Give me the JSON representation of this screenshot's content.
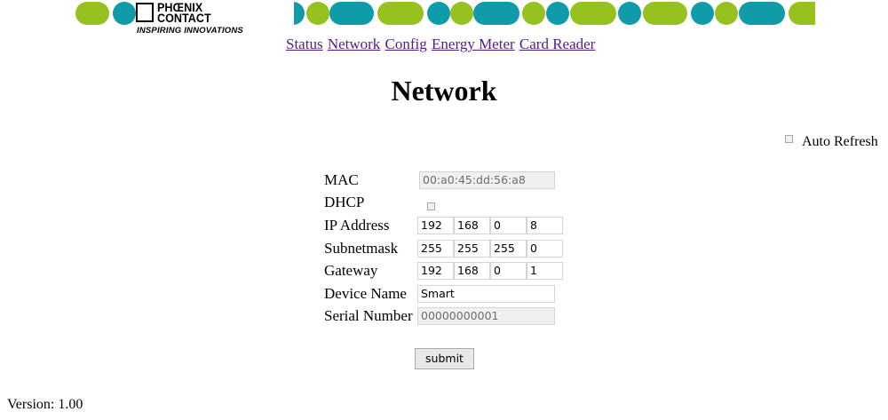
{
  "brand": {
    "logo_line1": "PHŒNIX",
    "logo_line2": "CONTACT",
    "tagline": "INSPIRING INNOVATIONS",
    "colors": {
      "green": "#96c11f",
      "teal": "#0f9ba7"
    }
  },
  "nav": {
    "items": [
      "Status",
      "Network",
      "Config",
      "Energy Meter",
      "Card Reader"
    ]
  },
  "page_title": "Network",
  "auto_refresh": {
    "label": "Auto Refresh",
    "checked": false
  },
  "form": {
    "mac": {
      "label": "MAC",
      "value": "00:a0:45:dd:56:a8"
    },
    "dhcp": {
      "label": "DHCP",
      "checked": false
    },
    "ip": {
      "label": "IP Address",
      "octets": [
        "192",
        "168",
        "0",
        "8"
      ]
    },
    "subnet": {
      "label": "Subnetmask",
      "octets": [
        "255",
        "255",
        "255",
        "0"
      ]
    },
    "gateway": {
      "label": "Gateway",
      "octets": [
        "192",
        "168",
        "0",
        "1"
      ]
    },
    "device_name": {
      "label": "Device Name",
      "value": "Smart"
    },
    "serial": {
      "label": "Serial Number",
      "value": "00000000001"
    }
  },
  "submit_label": "submit",
  "version": "Version: 1.00"
}
